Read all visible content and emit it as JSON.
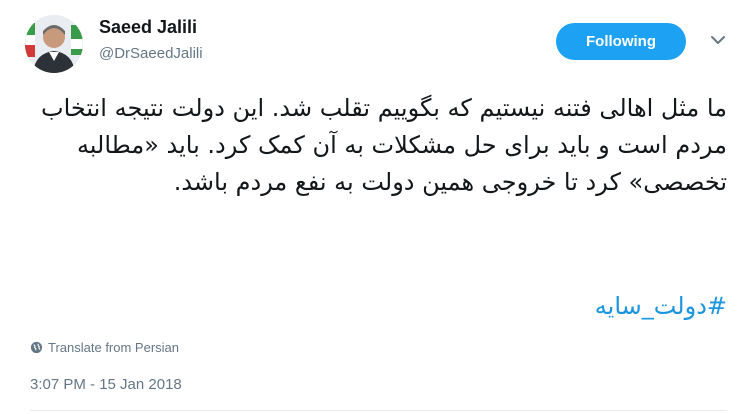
{
  "author": {
    "name": "Saeed Jalili",
    "handle": "@DrSaeedJalili"
  },
  "follow_button": {
    "label": "Following"
  },
  "tweet": {
    "text": "ما مثل اهالی فتنه نیستیم که بگوییم تقلب شد. این دولت نتیجه انتخاب مردم است و باید برای حل مشکلات به آن کمک کرد. باید «مطالبه تخصصی» کرد تا خروجی همین دولت به نفع مردم باشد.",
    "hashtag": "#دولت_سایه"
  },
  "translate_link": "Translate from Persian",
  "timestamp": "3:07 PM - 15 Jan 2018",
  "colors": {
    "accent": "#1da1f2",
    "hashtag": "#1b95e0",
    "meta_text": "#657786"
  },
  "icons": {
    "caret": "chevron-down-icon",
    "translate": "globe-icon"
  }
}
